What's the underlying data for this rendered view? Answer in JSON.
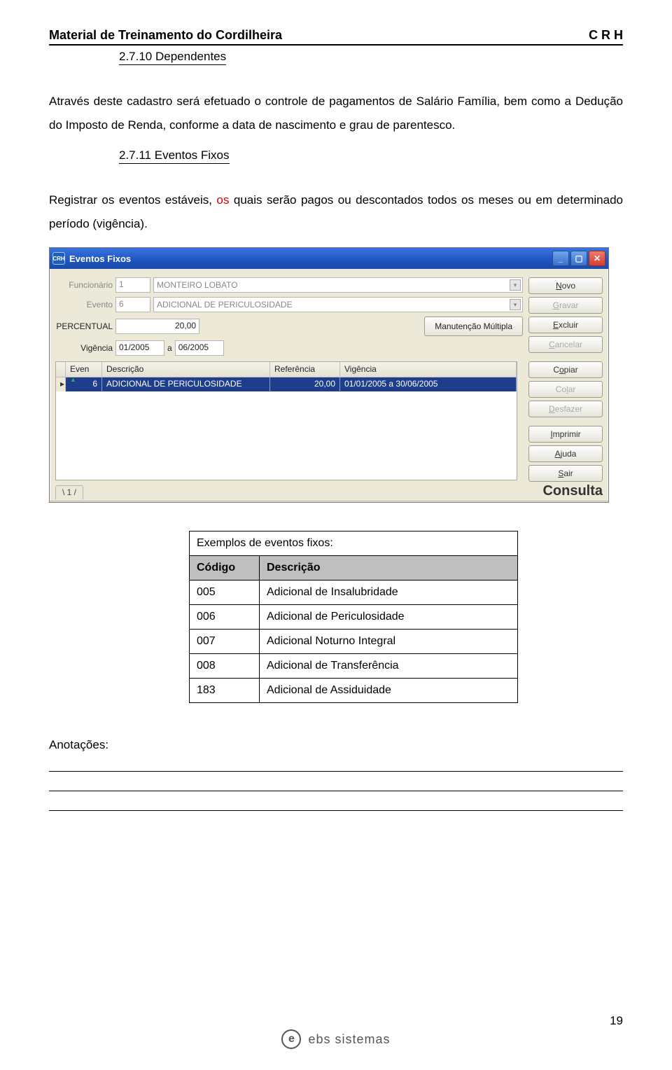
{
  "header": {
    "left": "Material de Treinamento do Cordilheira",
    "right": "C R H"
  },
  "section1": {
    "heading": "2.7.10 Dependentes",
    "para": "Através deste cadastro será efetuado o controle de pagamentos de Salário Família, bem como a Dedução do Imposto de Renda, conforme a data de nascimento e grau de parentesco."
  },
  "section2": {
    "heading": "2.7.11 Eventos Fixos",
    "para1": "Registrar os eventos estáveis, os quais serão pagos ou descontados todos os meses ou em determinado período (vigência).",
    "red_word": "os"
  },
  "window": {
    "title": "Eventos Fixos",
    "labels": {
      "funcionario": "Funcionário",
      "evento": "Evento",
      "percentual": "PERCENTUAL",
      "vigencia": "Vigência",
      "a": "a"
    },
    "values": {
      "func_code": "1",
      "func_name": "MONTEIRO LOBATO",
      "evento_code": "6",
      "evento_name": "ADICIONAL DE PERICULOSIDADE",
      "percentual": "20,00",
      "vig_from": "01/2005",
      "vig_to": "06/2005"
    },
    "manut_btn": "Manutenção Múltipla",
    "side_buttons": [
      "Novo",
      "Gravar",
      "Excluir",
      "Cancelar",
      "Copiar",
      "Colar",
      "Desfazer",
      "Imprimir",
      "Ajuda",
      "Sair"
    ],
    "side_enabled": [
      true,
      false,
      true,
      false,
      true,
      false,
      false,
      true,
      true,
      true
    ],
    "grid": {
      "headers": [
        "Even",
        "Descrição",
        "Referência",
        "Vigência"
      ],
      "row": {
        "even": "6",
        "desc": "ADICIONAL DE PERICULOSIDADE",
        "ref": "20,00",
        "vig": "01/01/2005 a 30/06/2005"
      }
    },
    "pager": "1",
    "mode": "Consulta"
  },
  "examples": {
    "title": "Exemplos de eventos fixos:",
    "head": {
      "code": "Código",
      "desc": "Descrição"
    },
    "rows": [
      {
        "code": "005",
        "desc": "Adicional de Insalubridade"
      },
      {
        "code": "006",
        "desc": "Adicional de Periculosidade"
      },
      {
        "code": "007",
        "desc": "Adicional Noturno Integral"
      },
      {
        "code": "008",
        "desc": "Adicional de Transferência"
      },
      {
        "code": "183",
        "desc": "Adicional de Assiduidade"
      }
    ]
  },
  "anot": "Anotações:",
  "page_num": "19",
  "footer_brand": "ebs sistemas"
}
